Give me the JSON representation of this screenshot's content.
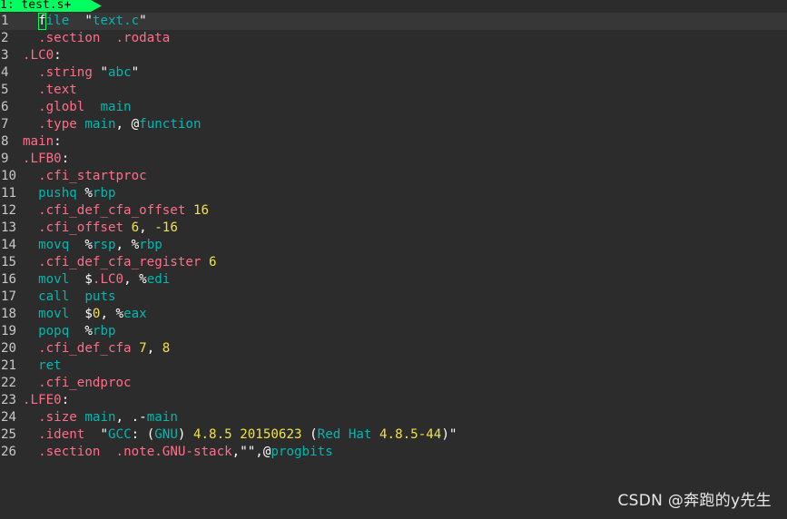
{
  "tab": {
    "label": "1: test.s+"
  },
  "colors": {
    "background": "#2c2c2c",
    "tab_active": "#00ff5f",
    "directive": "#ff6e89",
    "identifier": "#00b7b0",
    "number": "#f0e246",
    "line_number": "#c8c8c8",
    "plain_text": "#ffffff"
  },
  "editor": {
    "cursor_line": 1,
    "lines": [
      {
        "num": "1",
        "tokens": [
          [
            "ws",
            "  "
          ],
          [
            "cursor",
            "f"
          ],
          [
            "ident",
            "ile"
          ],
          [
            "ws",
            "  "
          ],
          [
            "plain",
            "\""
          ],
          [
            "str",
            "text.c"
          ],
          [
            "plain",
            "\""
          ]
        ]
      },
      {
        "num": "2",
        "tokens": [
          [
            "ws",
            "  "
          ],
          [
            "dir",
            ".section"
          ],
          [
            "ws",
            "  "
          ],
          [
            "dir",
            ".rodata"
          ]
        ]
      },
      {
        "num": "3",
        "tokens": [
          [
            "lbl",
            ".LC0"
          ],
          [
            "plain",
            ":"
          ]
        ]
      },
      {
        "num": "4",
        "tokens": [
          [
            "ws",
            "  "
          ],
          [
            "dir",
            ".string"
          ],
          [
            "ws",
            " "
          ],
          [
            "plain",
            "\""
          ],
          [
            "str",
            "abc"
          ],
          [
            "plain",
            "\""
          ]
        ]
      },
      {
        "num": "5",
        "tokens": [
          [
            "ws",
            "  "
          ],
          [
            "dir",
            ".text"
          ]
        ]
      },
      {
        "num": "6",
        "tokens": [
          [
            "ws",
            "  "
          ],
          [
            "dir",
            ".globl"
          ],
          [
            "ws",
            "  "
          ],
          [
            "ident",
            "main"
          ]
        ]
      },
      {
        "num": "7",
        "tokens": [
          [
            "ws",
            "  "
          ],
          [
            "dir",
            ".type"
          ],
          [
            "ws",
            " "
          ],
          [
            "ident",
            "main"
          ],
          [
            "plain",
            ", @"
          ],
          [
            "ident",
            "function"
          ]
        ]
      },
      {
        "num": "8",
        "tokens": [
          [
            "lbl",
            "main"
          ],
          [
            "plain",
            ":"
          ]
        ]
      },
      {
        "num": "9",
        "tokens": [
          [
            "lbl",
            ".LFB0"
          ],
          [
            "plain",
            ":"
          ]
        ]
      },
      {
        "num": "10",
        "tokens": [
          [
            "ws",
            "  "
          ],
          [
            "dir",
            ".cfi_startproc"
          ]
        ]
      },
      {
        "num": "11",
        "tokens": [
          [
            "ws",
            "  "
          ],
          [
            "ident",
            "pushq"
          ],
          [
            "ws",
            " "
          ],
          [
            "plain",
            "%"
          ],
          [
            "ident",
            "rbp"
          ]
        ]
      },
      {
        "num": "12",
        "tokens": [
          [
            "ws",
            "  "
          ],
          [
            "dir",
            ".cfi_def_cfa_offset"
          ],
          [
            "ws",
            " "
          ],
          [
            "num",
            "16"
          ]
        ]
      },
      {
        "num": "13",
        "tokens": [
          [
            "ws",
            "  "
          ],
          [
            "dir",
            ".cfi_offset"
          ],
          [
            "ws",
            " "
          ],
          [
            "num",
            "6"
          ],
          [
            "plain",
            ", "
          ],
          [
            "num",
            "-16"
          ]
        ]
      },
      {
        "num": "14",
        "tokens": [
          [
            "ws",
            "  "
          ],
          [
            "ident",
            "movq"
          ],
          [
            "ws",
            "  "
          ],
          [
            "plain",
            "%"
          ],
          [
            "ident",
            "rsp"
          ],
          [
            "plain",
            ", %"
          ],
          [
            "ident",
            "rbp"
          ]
        ]
      },
      {
        "num": "15",
        "tokens": [
          [
            "ws",
            "  "
          ],
          [
            "dir",
            ".cfi_def_cfa_register"
          ],
          [
            "ws",
            " "
          ],
          [
            "num",
            "6"
          ]
        ]
      },
      {
        "num": "16",
        "tokens": [
          [
            "ws",
            "  "
          ],
          [
            "ident",
            "movl"
          ],
          [
            "ws",
            "  "
          ],
          [
            "plain",
            "$"
          ],
          [
            "dir",
            ".LC0"
          ],
          [
            "plain",
            ", %"
          ],
          [
            "ident",
            "edi"
          ]
        ]
      },
      {
        "num": "17",
        "tokens": [
          [
            "ws",
            "  "
          ],
          [
            "ident",
            "call"
          ],
          [
            "ws",
            "  "
          ],
          [
            "ident",
            "puts"
          ]
        ]
      },
      {
        "num": "18",
        "tokens": [
          [
            "ws",
            "  "
          ],
          [
            "ident",
            "movl"
          ],
          [
            "ws",
            "  "
          ],
          [
            "plain",
            "$"
          ],
          [
            "num",
            "0"
          ],
          [
            "plain",
            ", %"
          ],
          [
            "ident",
            "eax"
          ]
        ]
      },
      {
        "num": "19",
        "tokens": [
          [
            "ws",
            "  "
          ],
          [
            "ident",
            "popq"
          ],
          [
            "ws",
            "  "
          ],
          [
            "plain",
            "%"
          ],
          [
            "ident",
            "rbp"
          ]
        ]
      },
      {
        "num": "20",
        "tokens": [
          [
            "ws",
            "  "
          ],
          [
            "dir",
            ".cfi_def_cfa"
          ],
          [
            "ws",
            " "
          ],
          [
            "num",
            "7"
          ],
          [
            "plain",
            ", "
          ],
          [
            "num",
            "8"
          ]
        ]
      },
      {
        "num": "21",
        "tokens": [
          [
            "ws",
            "  "
          ],
          [
            "ident",
            "ret"
          ]
        ]
      },
      {
        "num": "22",
        "tokens": [
          [
            "ws",
            "  "
          ],
          [
            "dir",
            ".cfi_endproc"
          ]
        ]
      },
      {
        "num": "23",
        "tokens": [
          [
            "lbl",
            ".LFE0"
          ],
          [
            "plain",
            ":"
          ]
        ]
      },
      {
        "num": "24",
        "tokens": [
          [
            "ws",
            "  "
          ],
          [
            "dir",
            ".size"
          ],
          [
            "ws",
            " "
          ],
          [
            "ident",
            "main"
          ],
          [
            "plain",
            ", .-"
          ],
          [
            "ident",
            "main"
          ]
        ]
      },
      {
        "num": "25",
        "tokens": [
          [
            "ws",
            "  "
          ],
          [
            "dir",
            ".ident"
          ],
          [
            "ws",
            "  "
          ],
          [
            "plain",
            "\""
          ],
          [
            "str",
            "GCC"
          ],
          [
            "plain",
            ": ("
          ],
          [
            "str",
            "GNU"
          ],
          [
            "plain",
            ") "
          ],
          [
            "num",
            "4.8.5"
          ],
          [
            "plain",
            " "
          ],
          [
            "num",
            "20150623"
          ],
          [
            "plain",
            " ("
          ],
          [
            "str",
            "Red Hat"
          ],
          [
            "plain",
            " "
          ],
          [
            "num",
            "4.8.5-44"
          ],
          [
            "plain",
            ")\""
          ]
        ]
      },
      {
        "num": "26",
        "tokens": [
          [
            "ws",
            "  "
          ],
          [
            "dir",
            ".section"
          ],
          [
            "ws",
            "  "
          ],
          [
            "dir",
            ".note.GNU-stack"
          ],
          [
            "plain",
            ",\"\",@"
          ],
          [
            "ident",
            "progbits"
          ]
        ]
      }
    ]
  },
  "watermark": {
    "text": "CSDN @奔跑的y先生"
  }
}
